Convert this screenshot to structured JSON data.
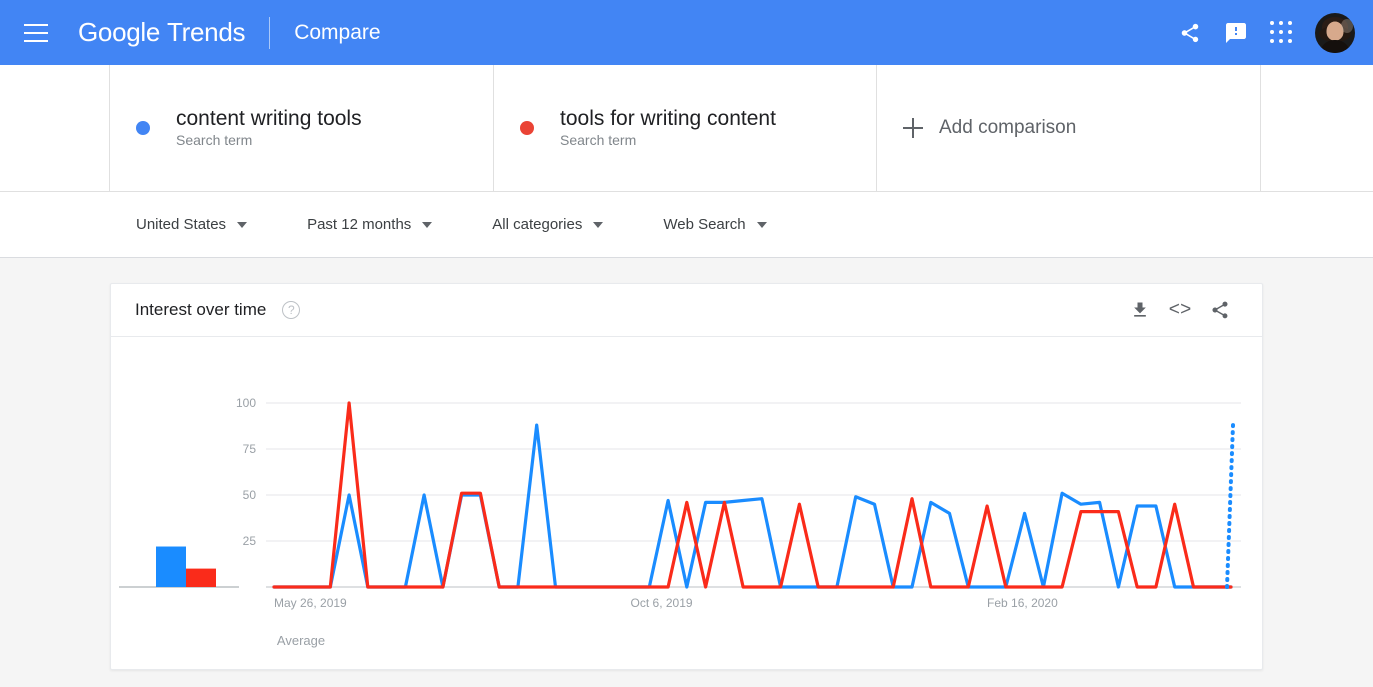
{
  "header": {
    "menu_icon": "hamburger-menu-icon",
    "brand_google": "Google",
    "brand_product": "Trends",
    "section_label": "Compare",
    "share_icon": "share-icon",
    "feedback_icon": "feedback-icon",
    "apps_icon": "apps-grid-icon",
    "avatar": "user-avatar"
  },
  "terms": [
    {
      "label": "content writing tools",
      "sublabel": "Search term",
      "color": "#4285f4"
    },
    {
      "label": "tools for writing content",
      "sublabel": "Search term",
      "color": "#ea4335"
    }
  ],
  "add_comparison": {
    "label": "Add comparison",
    "icon": "plus-icon"
  },
  "filters": [
    {
      "label": "United States"
    },
    {
      "label": "Past 12 months"
    },
    {
      "label": "All categories"
    },
    {
      "label": "Web Search"
    }
  ],
  "card": {
    "title": "Interest over time",
    "help_icon": "help-question-icon",
    "download_icon": "download-icon",
    "embed_icon": "embed-code-icon",
    "embed_glyph": "<>",
    "share_icon": "share-icon"
  },
  "chart_data": {
    "type": "line",
    "title": "Interest over time",
    "xlabel": "",
    "ylabel": "",
    "ylim": [
      0,
      100
    ],
    "yticks": [
      25,
      50,
      75,
      100
    ],
    "grid": true,
    "legend_position": "top",
    "xtick_labels": [
      "May 26, 2019",
      "Oct 6, 2019",
      "Feb 16, 2020"
    ],
    "xtick_positions": [
      0,
      19,
      38
    ],
    "average_panel": {
      "label": "Average",
      "values": [
        22,
        10
      ]
    },
    "partial_data_marker": {
      "style": "dotted",
      "series": "content writing tools",
      "value": 88
    },
    "series": [
      {
        "name": "content writing tools",
        "color": "#4285f4",
        "values": [
          0,
          0,
          0,
          0,
          50,
          0,
          0,
          0,
          50,
          0,
          50,
          50,
          0,
          0,
          88,
          0,
          0,
          0,
          0,
          0,
          0,
          47,
          0,
          46,
          46,
          47,
          48,
          0,
          0,
          0,
          0,
          49,
          45,
          0,
          0,
          46,
          40,
          0,
          0,
          0,
          40,
          0,
          51,
          45,
          46,
          0,
          44,
          44,
          0,
          0,
          0,
          0
        ]
      },
      {
        "name": "tools for writing content",
        "color": "#ea4335",
        "values": [
          0,
          0,
          0,
          0,
          100,
          0,
          0,
          0,
          0,
          0,
          51,
          51,
          0,
          0,
          0,
          0,
          0,
          0,
          0,
          0,
          0,
          0,
          46,
          0,
          46,
          0,
          0,
          0,
          45,
          0,
          0,
          0,
          0,
          0,
          48,
          0,
          0,
          0,
          44,
          0,
          0,
          0,
          0,
          41,
          41,
          41,
          0,
          0,
          45,
          0,
          0,
          0
        ]
      }
    ]
  }
}
